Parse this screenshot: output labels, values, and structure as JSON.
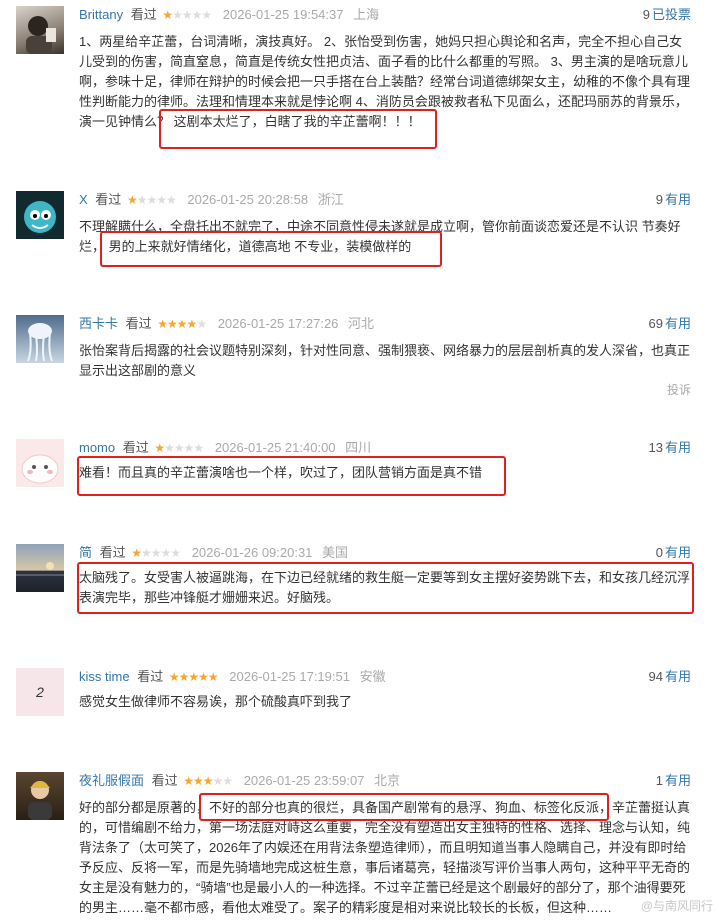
{
  "reviews": [
    {
      "user": "Brittany",
      "watched": "看过",
      "rating": 1,
      "time": "2026-01-25 19:54:37",
      "location": "上海",
      "votes_count": "9",
      "votes_label": "已投票",
      "body_plain": "1、两星给辛芷蕾，台词清晰，演技真好。 2、张怡受到伤害，她妈只担心舆论和名声，完全不担心自己女儿受到的伤害，简直窒息，简直是传统女性把贞洁、面子看的比什么都重的写照。 3、男主演的是啥玩意儿啊，参味十足，律师在辩护的时候会把一只手搭在台上装酷？经常台词道德绑架女主，幼稚的不像个具有理性判断能力的律师。法理和情理本来就是悖论啊 4、消防员会跟被救者私下见面么，还配玛丽苏的背景乐，演一见钟情么？",
      "body_highlight": "这剧本太烂了，白瞎了我的辛芷蕾啊！！！",
      "body_after": ""
    },
    {
      "user": "X",
      "watched": "看过",
      "rating": 1,
      "time": "2026-01-25 20:28:58",
      "location": "浙江",
      "votes_count": "9",
      "votes_label": "有用",
      "body_plain": "不理解瞒什么，全盘托出不就完了，中途不同意性侵未遂就是成立啊，管你前面谈恋爱还是不认识 节奏好烂，",
      "body_highlight": "男的上来就好情绪化，道德高地 不专业，装模做样的",
      "body_after": ""
    },
    {
      "user": "西卡卡",
      "watched": "看过",
      "rating": 4,
      "time": "2026-01-25 17:27:26",
      "location": "河北",
      "votes_count": "69",
      "votes_label": "有用",
      "body_plain": "张怡案背后揭露的社会议题特别深刻，针对性同意、强制猥亵、网络暴力的层层剖析真的发人深省，也真正显示出这部剧的意义",
      "body_highlight": "",
      "body_after": "",
      "report": "投诉"
    },
    {
      "user": "momo",
      "watched": "看过",
      "rating": 1,
      "time": "2026-01-25 21:40:00",
      "location": "四川",
      "votes_count": "13",
      "votes_label": "有用",
      "body_plain": "",
      "body_highlight": "难看！而且真的辛芷蕾演啥也一个样，吹过了，团队营销方面是真不错",
      "body_after": ""
    },
    {
      "user": "简",
      "watched": "看过",
      "rating": 1,
      "time": "2026-01-26 09:20:31",
      "location": "美国",
      "votes_count": "0",
      "votes_label": "有用",
      "body_plain": "",
      "body_highlight": "太脑残了。女受害人被逼跳海，在下边已经就绪的救生艇一定要等到女主摆好姿势跳下去，和女孩几经沉浮表演完毕，那些冲锋艇才姗姗来迟。好脑残。",
      "body_after": ""
    },
    {
      "user": "kiss time",
      "watched": "看过",
      "rating": 5,
      "time": "2026-01-25 17:19:51",
      "location": "安徽",
      "votes_count": "94",
      "votes_label": "有用",
      "body_plain": "感觉女生做律师不容易诶，那个硫酸真吓到我了",
      "body_highlight": "",
      "body_after": "",
      "avatar_text": "2"
    },
    {
      "user": "夜礼服假面",
      "watched": "看过",
      "rating": 3,
      "time": "2026-01-25 23:59:07",
      "location": "北京",
      "votes_count": "1",
      "votes_label": "有用",
      "body_plain": "好的部分都是原著的，",
      "body_highlight": "不好的部分也真的很烂，具备国产剧常有的悬浮、狗血、标签化反派，",
      "body_after": "辛芷蕾挺认真的，可惜编剧不给力，第一场法庭对峙这么重要，完全没有塑造出女主独特的性格、选择、理念与认知，纯背法条了（太可笑了，2026年了内娱还在用背法条塑造律师），而且明知道当事人隐瞒自己，并没有即时给予反应、反将一军，而是先骑墙地完成这桩生意，事后诸葛亮，轻描淡写评价当事人两句，这种平平无奇的女主是没有魅力的，“骑墙”也是最小人的一种选择。不过辛芷蕾已经是这个剧最好的部分了，那个油得要死的男主……毫不都市感，看他太难受了。案子的精彩度是相对来说比较长的长板，但这种……"
    }
  ],
  "watermark": "@与南风同行",
  "colors": {
    "link": "#3377aa",
    "star": "#f6a630",
    "highlight_border": "#e02020"
  }
}
